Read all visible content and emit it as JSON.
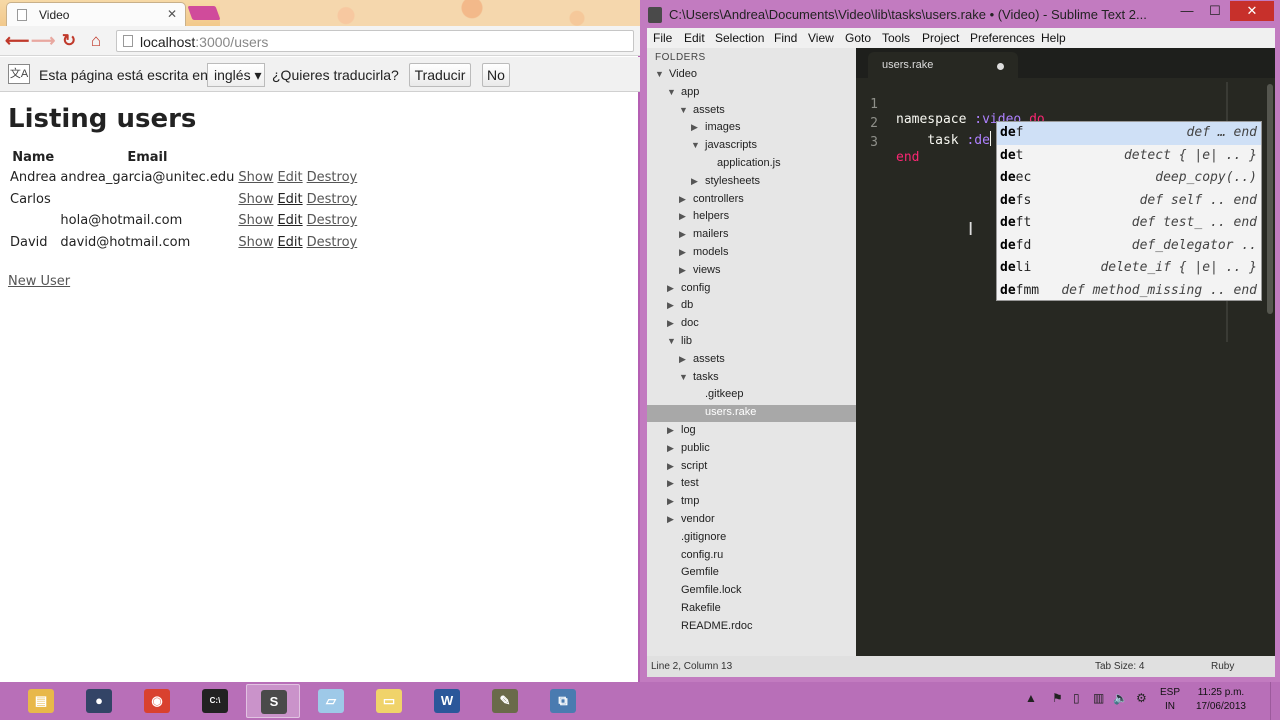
{
  "browser": {
    "tab_title": "Video",
    "tab_close": "✕",
    "url_host": "localhost",
    "url_path": ":3000/users",
    "translate": {
      "message_before": "Esta página está escrita en",
      "language": "inglés",
      "question": "¿Quieres traducirla?",
      "translate_button": "Traducir",
      "no_button": "No"
    },
    "page": {
      "title": "Listing users",
      "columns": [
        "Name",
        "Email"
      ],
      "rows": [
        {
          "name": "Andrea",
          "email": "andrea_garcia@unitec.edu"
        },
        {
          "name": "Carlos",
          "email": ""
        },
        {
          "name": "",
          "email": "hola@hotmail.com"
        },
        {
          "name": "David",
          "email": "david@hotmail.com"
        }
      ],
      "actions": {
        "show": "Show",
        "edit": "Edit",
        "destroy": "Destroy"
      },
      "new_user_link": "New User"
    }
  },
  "sublime": {
    "window_title": "C:\\Users\\Andrea\\Documents\\Video\\lib\\tasks\\users.rake • (Video) - Sublime Text 2...",
    "window_buttons": {
      "minimize": "—",
      "maximize": "☐",
      "close": "✕"
    },
    "menu": [
      "File",
      "Edit",
      "Selection",
      "Find",
      "View",
      "Goto",
      "Tools",
      "Project",
      "Preferences",
      "Help"
    ],
    "sidebar_header": "FOLDERS",
    "tree": [
      {
        "label": "Video",
        "arrow": "▼",
        "level": 0
      },
      {
        "label": "app",
        "arrow": "▼",
        "level": 1
      },
      {
        "label": "assets",
        "arrow": "▼",
        "level": 2
      },
      {
        "label": "images",
        "arrow": "▶",
        "level": 3
      },
      {
        "label": "javascripts",
        "arrow": "▼",
        "level": 3
      },
      {
        "label": "application.js",
        "arrow": "",
        "level": 4
      },
      {
        "label": "stylesheets",
        "arrow": "▶",
        "level": 3
      },
      {
        "label": "controllers",
        "arrow": "▶",
        "level": 2
      },
      {
        "label": "helpers",
        "arrow": "▶",
        "level": 2
      },
      {
        "label": "mailers",
        "arrow": "▶",
        "level": 2
      },
      {
        "label": "models",
        "arrow": "▶",
        "level": 2
      },
      {
        "label": "views",
        "arrow": "▶",
        "level": 2
      },
      {
        "label": "config",
        "arrow": "▶",
        "level": 1
      },
      {
        "label": "db",
        "arrow": "▶",
        "level": 1
      },
      {
        "label": "doc",
        "arrow": "▶",
        "level": 1
      },
      {
        "label": "lib",
        "arrow": "▼",
        "level": 1
      },
      {
        "label": "assets",
        "arrow": "▶",
        "level": 2
      },
      {
        "label": "tasks",
        "arrow": "▼",
        "level": 2
      },
      {
        "label": ".gitkeep",
        "arrow": "",
        "level": 3
      },
      {
        "label": "users.rake",
        "arrow": "",
        "level": 3,
        "selected": true
      },
      {
        "label": "log",
        "arrow": "▶",
        "level": 1
      },
      {
        "label": "public",
        "arrow": "▶",
        "level": 1
      },
      {
        "label": "script",
        "arrow": "▶",
        "level": 1
      },
      {
        "label": "test",
        "arrow": "▶",
        "level": 1
      },
      {
        "label": "tmp",
        "arrow": "▶",
        "level": 1
      },
      {
        "label": "vendor",
        "arrow": "▶",
        "level": 1
      },
      {
        "label": ".gitignore",
        "arrow": "",
        "level": 1
      },
      {
        "label": "config.ru",
        "arrow": "",
        "level": 1
      },
      {
        "label": "Gemfile",
        "arrow": "",
        "level": 1
      },
      {
        "label": "Gemfile.lock",
        "arrow": "",
        "level": 1
      },
      {
        "label": "Rakefile",
        "arrow": "",
        "level": 1
      },
      {
        "label": "README.rdoc",
        "arrow": "",
        "level": 1
      }
    ],
    "editor_tab": "users.rake",
    "code": {
      "line_numbers": [
        "1",
        "2",
        "3"
      ],
      "line1": {
        "kw1": "namespace",
        "sym": ":video",
        "kw2": "do"
      },
      "line2": {
        "indent": "    ",
        "kw": "task",
        "sym": ":de"
      },
      "line3": {
        "kw": "end"
      }
    },
    "autocomplete": [
      {
        "typed": "de",
        "rest": "f",
        "hint": "def … end"
      },
      {
        "typed": "de",
        "rest": "t",
        "hint": "detect { |e| .. }"
      },
      {
        "typed": "de",
        "rest": "ec",
        "hint": "deep_copy(..)"
      },
      {
        "typed": "de",
        "rest": "fs",
        "hint": "def self .. end"
      },
      {
        "typed": "de",
        "rest": "ft",
        "hint": "def test_ .. end"
      },
      {
        "typed": "de",
        "rest": "fd",
        "hint": "def_delegator .."
      },
      {
        "typed": "de",
        "rest": "li",
        "hint": "delete_if { |e| .. }"
      },
      {
        "typed": "de",
        "rest": "fmm",
        "hint": "def method_missing .. end"
      }
    ],
    "status": {
      "position": "Line 2, Column 13",
      "tab_size": "Tab Size: 4",
      "syntax": "Ruby"
    }
  },
  "taskbar": {
    "apps": [
      {
        "name": "File Explorer",
        "icon": "folder-icon",
        "color": "#e8b84a"
      },
      {
        "name": "Globe",
        "icon": "globe-icon",
        "color": "#334466"
      },
      {
        "name": "Chrome",
        "icon": "chrome-icon",
        "color": "#d9412f"
      },
      {
        "name": "Command Prompt",
        "icon": "terminal-icon",
        "color": "#222222"
      },
      {
        "name": "Sublime Text",
        "icon": "sublime-icon",
        "color": "#4a4a4a"
      },
      {
        "name": "Notes",
        "icon": "notepad-icon",
        "color": "#9ec9e8"
      },
      {
        "name": "Folder",
        "icon": "folder2-icon",
        "color": "#f0d36a"
      },
      {
        "name": "Word",
        "icon": "word-icon",
        "color": "#2b579a"
      },
      {
        "name": "Tool",
        "icon": "tool-icon",
        "color": "#6a6a4a"
      },
      {
        "name": "Remote",
        "icon": "network-icon",
        "color": "#4a7bb0"
      }
    ],
    "lang_line1": "ESP",
    "lang_line2": "IN",
    "time": "11:25 p.m.",
    "date": "17/06/2013"
  }
}
